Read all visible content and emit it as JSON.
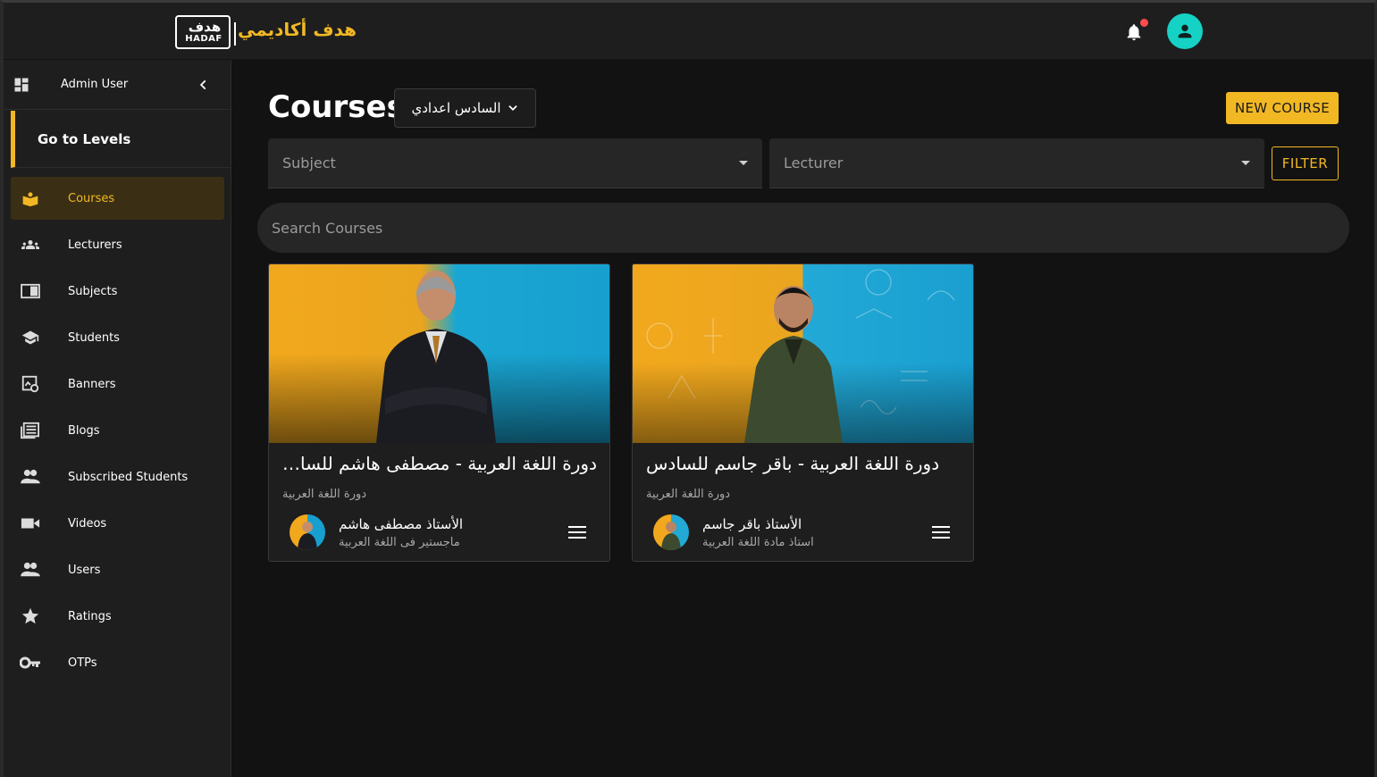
{
  "header": {
    "logo_ar": "هدف",
    "logo_en": "HADAF",
    "brand_name": "هدف أكاديمي",
    "accent": "#f2b824",
    "avatar_color": "#15d2c4",
    "notification_dot": "#ff4b4b"
  },
  "sidebar": {
    "user_name": "Admin User",
    "go_levels": "Go to Levels",
    "items": [
      {
        "label": "Courses",
        "icon": "courses-icon",
        "active": true
      },
      {
        "label": "Lecturers",
        "icon": "groups-icon"
      },
      {
        "label": "Subjects",
        "icon": "book-icon"
      },
      {
        "label": "Students",
        "icon": "school-icon"
      },
      {
        "label": "Banners",
        "icon": "banner-icon"
      },
      {
        "label": "Blogs",
        "icon": "newspaper-icon"
      },
      {
        "label": "Subscribed Students",
        "icon": "people-icon"
      },
      {
        "label": "Videos",
        "icon": "video-camera-icon"
      },
      {
        "label": "Users",
        "icon": "people-icon"
      },
      {
        "label": "Ratings",
        "icon": "star-icon"
      },
      {
        "label": "OTPs",
        "icon": "key-icon"
      }
    ]
  },
  "main": {
    "title": "Courses",
    "level_select": "السادس اعدادي",
    "new_course": "NEW COURSE",
    "subject_placeholder": "Subject",
    "lecturer_placeholder": "Lecturer",
    "filter": "FILTER",
    "search_placeholder": "Search Courses"
  },
  "courses": [
    {
      "title": "دورة اللغة العربية - مصطفى هاشم للسادس",
      "subtitle": "دورة اللغة العربية",
      "lecturer": "الأستاذ مصطفى هاشم",
      "lecturer_desc": "ماجستير فى اللغة العربية"
    },
    {
      "title": "دورة اللغة العربية - باقر جاسم للسادس",
      "subtitle": "دورة اللغة العربية",
      "lecturer": "الأستاذ باقر جاسم",
      "lecturer_desc": "استاذ مادة اللغة العربية"
    }
  ]
}
